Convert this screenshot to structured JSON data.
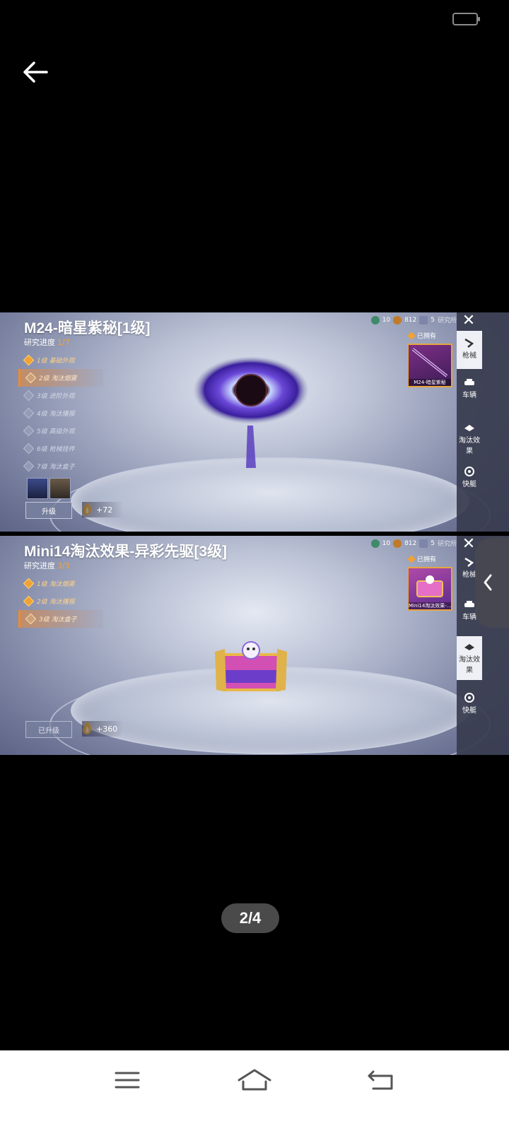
{
  "viewer": {
    "page_indicator": "2/4"
  },
  "panels": [
    {
      "title": "M24-暗星紫秘[1级]",
      "progress_label": "研究进度",
      "progress_value": "1/7",
      "levels": [
        {
          "text": "1级 基础外观",
          "state": "done"
        },
        {
          "text": "2级 淘汰烟雾",
          "state": "current"
        },
        {
          "text": "3级 进阶外观",
          "state": "locked"
        },
        {
          "text": "4级 淘汰播报",
          "state": "locked"
        },
        {
          "text": "5级 高级外观",
          "state": "locked"
        },
        {
          "text": "6级 枪械挂件",
          "state": "locked"
        },
        {
          "text": "7级 淘汰盒子",
          "state": "locked"
        }
      ],
      "upgrade_label": "升级",
      "points": "+72",
      "owned_label": "已拥有",
      "item_label": "M24-暗星紫秘",
      "currency": [
        "10",
        "812",
        "5"
      ],
      "research_label": "研究所",
      "sidebar": [
        "枪械",
        "车辆",
        "淘汰效果",
        "快艇"
      ],
      "active_tab": 0
    },
    {
      "title": "Mini14淘汰效果-异彩先驱[3级]",
      "progress_label": "研究进度",
      "progress_value": "3/3",
      "levels": [
        {
          "text": "1级 淘汰烟雾",
          "state": "done"
        },
        {
          "text": "2级 淘汰播报",
          "state": "done"
        },
        {
          "text": "3级 淘汰盒子",
          "state": "current"
        }
      ],
      "upgrade_label": "已升级",
      "points": "+360",
      "owned_label": "已拥有",
      "item_label": "Mini14淘汰效果-...",
      "currency": [
        "10",
        "812",
        "5"
      ],
      "research_label": "研究所",
      "sidebar": [
        "枪械",
        "车辆",
        "淘汰效果",
        "快艇"
      ],
      "active_tab": 2
    }
  ],
  "colors": {
    "accent": "#f0a233",
    "sidebar": "#383c4e",
    "pager_bg": "#4a4a4a"
  },
  "icons": [
    "back-arrow-icon",
    "battery-icon",
    "close-icon",
    "gun-icon",
    "car-icon",
    "elimination-effect-icon",
    "boat-icon",
    "flame-icon",
    "side-collapse-icon",
    "menu-icon",
    "home-icon",
    "return-icon"
  ]
}
